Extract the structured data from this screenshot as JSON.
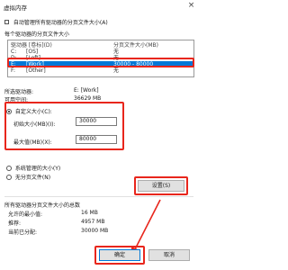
{
  "window": {
    "title": "虚拟内存",
    "close_glyph": "×"
  },
  "auto_manage": {
    "label": "自动管理所有驱动器的分页文件大小(A)",
    "checked": false
  },
  "section_title": "每个驱动器的分页文件大小",
  "list": {
    "headers": {
      "drive": "驱动器 [卷标](D)",
      "size": "分页文件大小(MB)"
    },
    "rows": [
      {
        "letter": "C:",
        "label": "[OS]",
        "size": "无",
        "selected": false
      },
      {
        "letter": "D:",
        "label": "[Loft]",
        "size": "无",
        "selected": false
      },
      {
        "letter": "E:",
        "label": "[Work]",
        "size": "30000 - 80000",
        "selected": true
      },
      {
        "letter": "F:",
        "label": "[Other]",
        "size": "无",
        "selected": false
      }
    ]
  },
  "selected_drive": {
    "label": "所选驱动器:",
    "value": "E: [Work]"
  },
  "available_space": {
    "label": "可用空间:",
    "value": "36629 MB"
  },
  "custom_size": {
    "label": "自定义大小(C):",
    "initial": {
      "label": "初始大小(MB)(I):",
      "value": "30000"
    },
    "maximum": {
      "label": "最大值(MB)(X):",
      "value": "80000"
    }
  },
  "system_managed": {
    "label": "系统管理的大小(Y)"
  },
  "no_paging": {
    "label": "无分页文件(N)"
  },
  "set_button": "设置(S)",
  "totals": {
    "title": "所有驱动器分页文件大小的总数",
    "min_allowed": {
      "label": "允许的最小值:",
      "value": "16 MB"
    },
    "recommended": {
      "label": "推荐:",
      "value": "4957 MB"
    },
    "allocated": {
      "label": "当前已分配:",
      "value": "30000 MB"
    }
  },
  "ok_button": "确定",
  "cancel_button": "取消",
  "colors": {
    "accent": "#0078d7",
    "annotation_red": "#e8261c"
  }
}
